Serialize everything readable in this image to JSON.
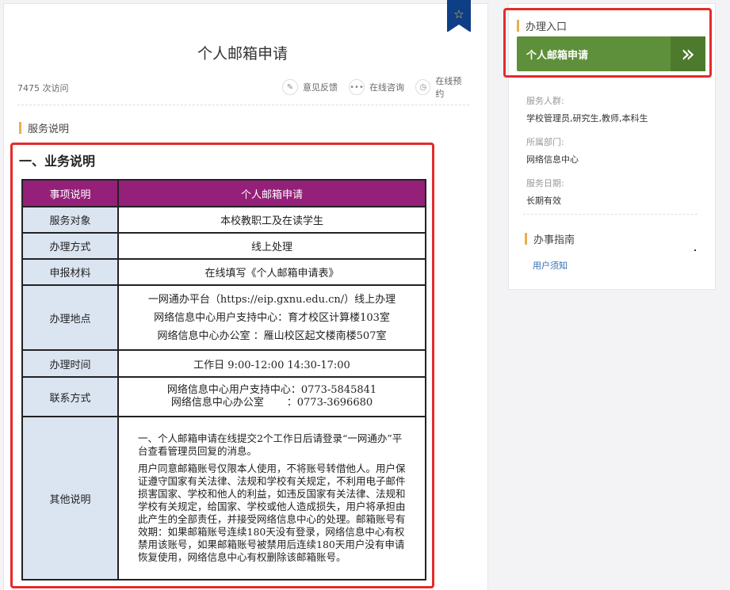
{
  "page": {
    "title": "个人邮箱申请",
    "visits": "7475 次访问",
    "actions": [
      {
        "icon": "pencil-icon",
        "label": "意见反馈"
      },
      {
        "icon": "chat-icon",
        "label": "在线咨询"
      },
      {
        "icon": "clock-icon",
        "label": "在线预约"
      }
    ],
    "section_label": "服务说明",
    "biz_title": "一、业务说明"
  },
  "table": {
    "header": {
      "label": "事项说明",
      "value": "个人邮箱申请"
    },
    "rows": [
      {
        "label": "服务对象",
        "value": "本校教职工及在读学生"
      },
      {
        "label": "办理方式",
        "value": "线上处理"
      },
      {
        "label": "申报材料",
        "value": "在线填写《个人邮箱申请表》"
      },
      {
        "label": "办理地点",
        "lines": [
          "一网通办平台（https://eip.gxnu.edu.cn/）线上办理",
          "网络信息中心用户支持中心：育才校区计算楼103室",
          "网络信息中心办公室 ：雁山校区起文楼南楼507室"
        ]
      },
      {
        "label": "办理时间",
        "value": "工作日 9:00-12:00 14:30-17:00"
      },
      {
        "label": "联系方式",
        "lines": [
          "网络信息中心用户支持中心：0773-5845841",
          "网络信息中心办公室       ：0773-3696680"
        ]
      },
      {
        "label": "其他说明",
        "paragraphs": [
          "一、个人邮箱申请在线提交2个工作日后请登录“一网通办”平台查看管理员回复的消息。",
          "用户同意邮箱账号仅限本人使用，不将账号转借他人。用户保证遵守国家有关法律、法规和学校有关规定，不利用电子邮件损害国家、学校和他人的利益，如违反国家有关法律、法规和学校有关规定，给国家、学校或他人造成损失，用户将承担由此产生的全部责任，并接受网络信息中心的处理。邮箱账号有效期：如果邮箱账号连续180天没有登录，网络信息中心有权禁用该账号，如果邮箱账号被禁用后连续180天用户没有申请恢复使用，网络信息中心有权删除该邮箱账号。"
        ]
      }
    ]
  },
  "sidebar": {
    "entry_label": "办理入口",
    "entry_button": "个人邮箱申请",
    "service_people_key": "服务人群:",
    "service_people_value": "学校管理员,研究生,教师,本科生",
    "department_key": "所属部门:",
    "department_value": "网络信息中心",
    "service_date_key": "服务日期:",
    "service_date_value": "长期有效",
    "guide_label": "办事指南",
    "guide_link": "用户须知"
  },
  "colors": {
    "table_header": "#95207a",
    "table_label_bg": "#dbe5f1",
    "entry_button": "#5e8f3a",
    "highlight_frame": "#e62a2a",
    "accent_bar": "#e6b04e",
    "bookmark": "#0e3f86"
  }
}
